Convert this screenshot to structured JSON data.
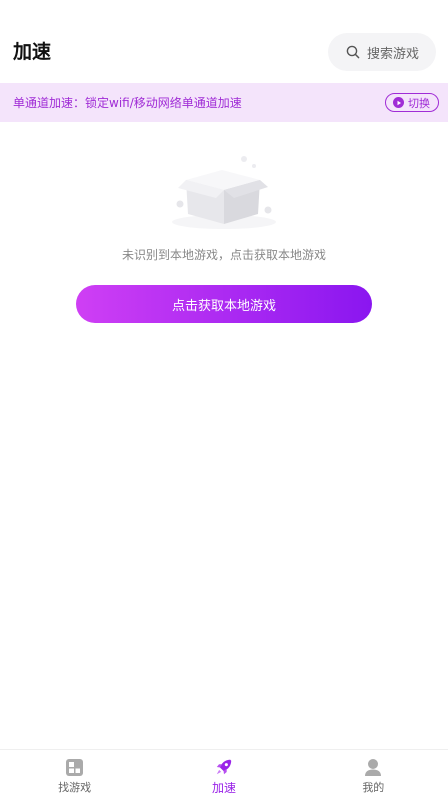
{
  "header": {
    "title": "加速",
    "search_placeholder": "搜索游戏"
  },
  "banner": {
    "text": "单通道加速：锁定wifi/移动网络单通道加速",
    "switch_label": "切换"
  },
  "empty_state": {
    "message": "未识别到本地游戏，点击获取本地游戏",
    "button_label": "点击获取本地游戏"
  },
  "bottom_nav": {
    "items": [
      {
        "label": "找游戏",
        "icon": "grid-icon",
        "active": false
      },
      {
        "label": "加速",
        "icon": "rocket-icon",
        "active": true
      },
      {
        "label": "我的",
        "icon": "user-icon",
        "active": false
      }
    ]
  },
  "colors": {
    "accent": "#a02cd6",
    "gradient_start": "#cf3ff4",
    "gradient_end": "#8a16f0",
    "banner_bg": "#f4e4fb"
  }
}
